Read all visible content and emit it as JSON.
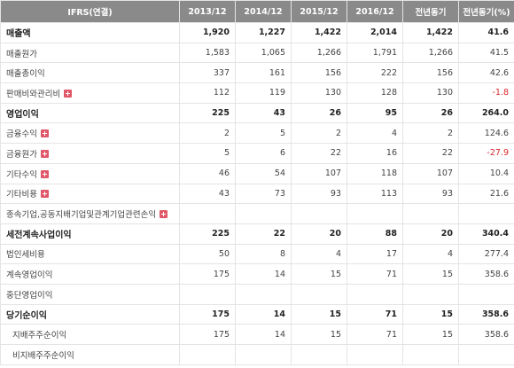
{
  "header": {
    "label": "IFRS(연결)",
    "columns": [
      "2013/12",
      "2014/12",
      "2015/12",
      "2016/12",
      "전년동기",
      "전년동기(%)"
    ]
  },
  "rows": [
    {
      "label": "매출액",
      "bold": true,
      "expand": false,
      "indent": false,
      "values": [
        "1,920",
        "1,227",
        "1,422",
        "2,014",
        "1,422",
        "41.6"
      ],
      "neg": false
    },
    {
      "label": "매출원가",
      "bold": false,
      "expand": false,
      "indent": false,
      "values": [
        "1,583",
        "1,065",
        "1,266",
        "1,791",
        "1,266",
        "41.5"
      ],
      "neg": false
    },
    {
      "label": "매출총이익",
      "bold": false,
      "expand": false,
      "indent": false,
      "values": [
        "337",
        "161",
        "156",
        "222",
        "156",
        "42.6"
      ],
      "neg": false
    },
    {
      "label": "판매비와관리비",
      "bold": false,
      "expand": true,
      "indent": false,
      "values": [
        "112",
        "119",
        "130",
        "128",
        "130",
        "-1.8"
      ],
      "neg": true
    },
    {
      "label": "영업이익",
      "bold": true,
      "expand": false,
      "indent": false,
      "values": [
        "225",
        "43",
        "26",
        "95",
        "26",
        "264.0"
      ],
      "neg": false
    },
    {
      "label": "금융수익",
      "bold": false,
      "expand": true,
      "indent": false,
      "values": [
        "2",
        "5",
        "2",
        "4",
        "2",
        "124.6"
      ],
      "neg": false
    },
    {
      "label": "금융원가",
      "bold": false,
      "expand": true,
      "indent": false,
      "values": [
        "5",
        "6",
        "22",
        "16",
        "22",
        "-27.9"
      ],
      "neg": true
    },
    {
      "label": "기타수익",
      "bold": false,
      "expand": true,
      "indent": false,
      "values": [
        "46",
        "54",
        "107",
        "118",
        "107",
        "10.4"
      ],
      "neg": false
    },
    {
      "label": "기타비용",
      "bold": false,
      "expand": true,
      "indent": false,
      "values": [
        "43",
        "73",
        "93",
        "113",
        "93",
        "21.6"
      ],
      "neg": false
    },
    {
      "label": "종속기업,공동지배기업및관계기업관련손익",
      "bold": false,
      "expand": true,
      "indent": false,
      "values": [
        "",
        "",
        "",
        "",
        "",
        ""
      ],
      "neg": false
    },
    {
      "label": "세전계속사업이익",
      "bold": true,
      "expand": false,
      "indent": false,
      "values": [
        "225",
        "22",
        "20",
        "88",
        "20",
        "340.4"
      ],
      "neg": false
    },
    {
      "label": "법인세비용",
      "bold": false,
      "expand": false,
      "indent": false,
      "values": [
        "50",
        "8",
        "4",
        "17",
        "4",
        "277.4"
      ],
      "neg": false
    },
    {
      "label": "계속영업이익",
      "bold": false,
      "expand": false,
      "indent": false,
      "values": [
        "175",
        "14",
        "15",
        "71",
        "15",
        "358.6"
      ],
      "neg": false
    },
    {
      "label": "중단영업이익",
      "bold": false,
      "expand": false,
      "indent": false,
      "values": [
        "",
        "",
        "",
        "",
        "",
        ""
      ],
      "neg": false
    },
    {
      "label": "당기순이익",
      "bold": true,
      "expand": false,
      "indent": false,
      "values": [
        "175",
        "14",
        "15",
        "71",
        "15",
        "358.6"
      ],
      "neg": false
    },
    {
      "label": "지배주주순이익",
      "bold": false,
      "expand": false,
      "indent": true,
      "values": [
        "175",
        "14",
        "15",
        "71",
        "15",
        "358.6"
      ],
      "neg": false
    },
    {
      "label": "비지배주주순이익",
      "bold": false,
      "expand": false,
      "indent": true,
      "values": [
        "",
        "",
        "",
        "",
        "",
        ""
      ],
      "neg": false
    }
  ]
}
